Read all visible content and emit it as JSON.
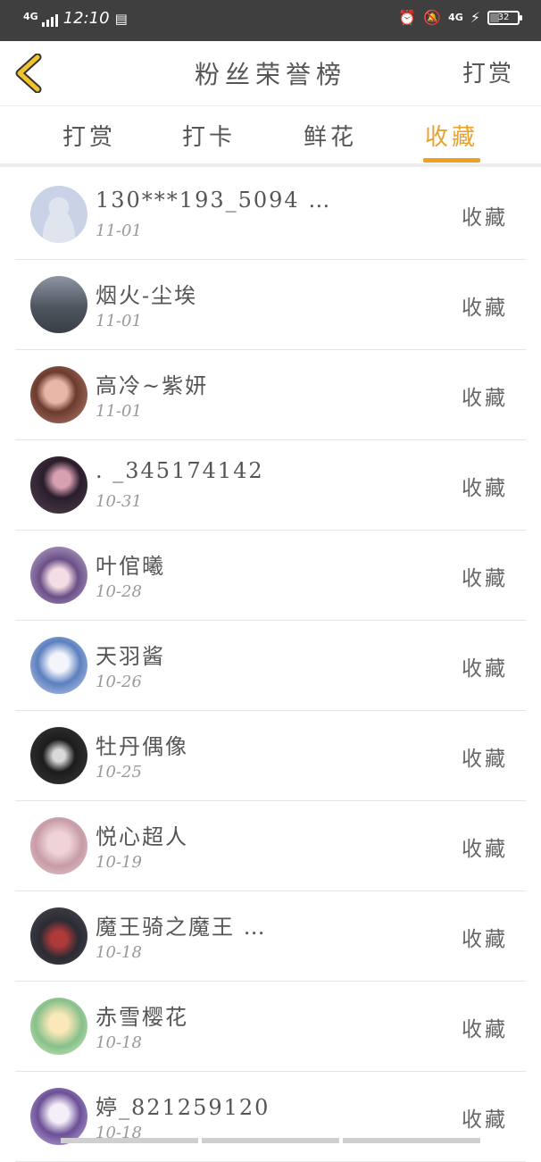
{
  "status_bar": {
    "network": "4G",
    "time": "12:10",
    "network_right": "4G",
    "battery": "32",
    "battery_level_percent": 32
  },
  "header": {
    "title": "粉丝荣誉榜",
    "action_label": "打赏",
    "back_icon": "chevron-left-icon",
    "accent": "#f0a020"
  },
  "tabs": [
    {
      "label": "打赏",
      "active": false
    },
    {
      "label": "打卡",
      "active": false
    },
    {
      "label": "鲜花",
      "active": false
    },
    {
      "label": "收藏",
      "active": true
    }
  ],
  "fans": [
    {
      "name": "130***193_5094 …",
      "date": "11-01",
      "badge": "收藏",
      "avatar": "default-avatar"
    },
    {
      "name": "烟火-尘埃",
      "date": "11-01",
      "badge": "收藏",
      "avatar": "photo-avatar"
    },
    {
      "name": "高冷~紫妍",
      "date": "11-01",
      "badge": "收藏",
      "avatar": "photo-avatar"
    },
    {
      "name": ". _345174142",
      "date": "10-31",
      "badge": "收藏",
      "avatar": "anime-avatar"
    },
    {
      "name": "叶倌曦",
      "date": "10-28",
      "badge": "收藏",
      "avatar": "anime-avatar"
    },
    {
      "name": "天羽酱",
      "date": "10-26",
      "badge": "收藏",
      "avatar": "anime-avatar"
    },
    {
      "name": "牡丹偶像",
      "date": "10-25",
      "badge": "收藏",
      "avatar": "anime-avatar"
    },
    {
      "name": "悦心超人",
      "date": "10-19",
      "badge": "收藏",
      "avatar": "anime-avatar"
    },
    {
      "name": "魔王骑之魔王 …",
      "date": "10-18",
      "badge": "收藏",
      "avatar": "anime-avatar"
    },
    {
      "name": "赤雪樱花",
      "date": "10-18",
      "badge": "收藏",
      "avatar": "anime-avatar"
    },
    {
      "name": "婷_821259120",
      "date": "10-18",
      "badge": "收藏",
      "avatar": "anime-avatar"
    }
  ]
}
